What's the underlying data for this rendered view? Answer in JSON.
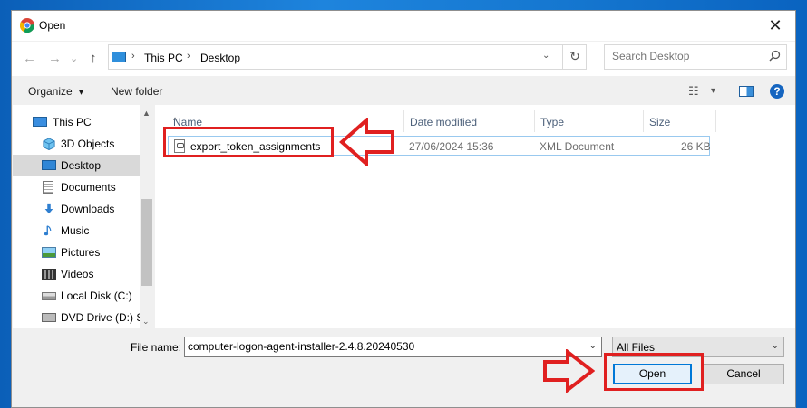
{
  "dialog": {
    "title": "Open",
    "close_glyph": "✕"
  },
  "nav": {
    "back_glyph": "←",
    "forward_glyph": "→",
    "recent_glyph": "⌄",
    "up_glyph": "↑",
    "breadcrumb": [
      "This PC",
      "Desktop"
    ],
    "breadcrumb_sep": "›",
    "dropdown_glyph": "⌄",
    "refresh_glyph": "↻",
    "search_placeholder": "Search Desktop",
    "search_icon": "search-icon"
  },
  "toolbar": {
    "organize_label": "Organize",
    "organize_caret": "▾",
    "new_folder_label": "New folder",
    "view_glyph": "☷",
    "view_caret": "▾",
    "help_glyph": "?"
  },
  "sidebar": {
    "items": [
      {
        "label": "This PC",
        "icon": "computer-icon"
      },
      {
        "label": "3D Objects",
        "icon": "cube-icon"
      },
      {
        "label": "Desktop",
        "icon": "desktop-icon",
        "selected": true
      },
      {
        "label": "Documents",
        "icon": "document-icon"
      },
      {
        "label": "Downloads",
        "icon": "download-icon"
      },
      {
        "label": "Music",
        "icon": "music-icon"
      },
      {
        "label": "Pictures",
        "icon": "pictures-icon"
      },
      {
        "label": "Videos",
        "icon": "video-icon"
      },
      {
        "label": "Local Disk (C:)",
        "icon": "drive-icon"
      },
      {
        "label": "DVD Drive (D:) S:",
        "icon": "dvd-icon"
      }
    ],
    "scroll_up": "▲",
    "scroll_down": "⌄"
  },
  "file_list": {
    "sort_glyph": "^",
    "columns": [
      "Name",
      "Date modified",
      "Type",
      "Size"
    ],
    "rows": [
      {
        "name": "export_token_assignments",
        "date": "27/06/2024 15:36",
        "type": "XML Document",
        "size": "26 KB"
      }
    ]
  },
  "footer": {
    "file_name_label": "File name:",
    "file_name_value": "computer-logon-agent-installer-2.4.8.20240530",
    "file_type": "All Files",
    "dropdown_glyph": "⌄",
    "open_label": "Open",
    "cancel_label": "Cancel"
  },
  "colors": {
    "annotation": "#e02020",
    "accent": "#0078d7",
    "selection": "#d9d9d9"
  }
}
